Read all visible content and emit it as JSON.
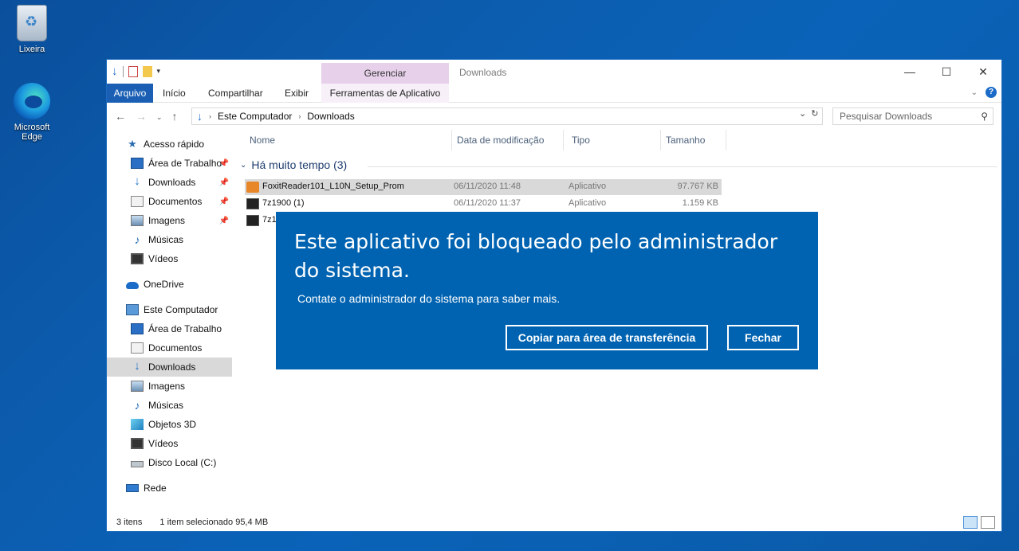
{
  "desktop": {
    "recycle_bin_label": "Lixeira",
    "edge_label": "Microsoft Edge"
  },
  "window": {
    "title": "Downloads",
    "contextual_group": "Gerenciar",
    "controls": [
      "—",
      "☐",
      "✕"
    ]
  },
  "ribbon": {
    "tabs": [
      "Arquivo",
      "Início",
      "Compartilhar",
      "Exibir",
      "Ferramentas de Aplicativo"
    ],
    "help": "?"
  },
  "address": {
    "breadcrumb": [
      "Este Computador",
      "Downloads"
    ],
    "search_placeholder": "Pesquisar Downloads"
  },
  "nav": {
    "items": [
      {
        "label": "Acesso rápido",
        "icon": "star-icon",
        "pinned": false
      },
      {
        "label": "Área de Trabalho",
        "icon": "desktop-icon",
        "pinned": true
      },
      {
        "label": "Downloads",
        "icon": "download-icon",
        "pinned": true
      },
      {
        "label": "Documentos",
        "icon": "document-icon",
        "pinned": true
      },
      {
        "label": "Imagens",
        "icon": "image-icon",
        "pinned": true
      },
      {
        "label": "Músicas",
        "icon": "music-icon",
        "pinned": false
      },
      {
        "label": "Vídeos",
        "icon": "video-icon",
        "pinned": false
      },
      {
        "label": "OneDrive",
        "icon": "cloud-icon",
        "pinned": false
      },
      {
        "label": "Este Computador",
        "icon": "computer-icon",
        "pinned": false
      },
      {
        "label": "Área de Trabalho",
        "icon": "desktop-icon",
        "pinned": false
      },
      {
        "label": "Documentos",
        "icon": "document-icon",
        "pinned": false
      },
      {
        "label": "Downloads",
        "icon": "download-icon",
        "pinned": false,
        "selected": true
      },
      {
        "label": "Imagens",
        "icon": "image-icon",
        "pinned": false
      },
      {
        "label": "Músicas",
        "icon": "music-icon",
        "pinned": false
      },
      {
        "label": "Objetos 3D",
        "icon": "cube-icon",
        "pinned": false
      },
      {
        "label": "Vídeos",
        "icon": "video-icon",
        "pinned": false
      },
      {
        "label": "Disco Local (C:)",
        "icon": "drive-icon",
        "pinned": false
      },
      {
        "label": "Rede",
        "icon": "network-icon",
        "pinned": false
      }
    ]
  },
  "files": {
    "columns": [
      "Nome",
      "Data de modificação",
      "Tipo",
      "Tamanho"
    ],
    "group_label": "Há muito tempo (3)",
    "rows": [
      {
        "name": "FoxitReader101_L10N_Setup_Prom",
        "date": "06/11/2020 11:48",
        "type": "Aplicativo",
        "size": "97.767 KB",
        "icon": "foxit-icon",
        "selected": true
      },
      {
        "name": "7z1900 (1)",
        "date": "06/11/2020 11:37",
        "type": "Aplicativo",
        "size": "1.159 KB",
        "icon": "7zip-icon",
        "selected": false
      },
      {
        "name": "7z1",
        "date": "",
        "type": "",
        "size": "",
        "icon": "7zip-icon",
        "selected": false
      }
    ]
  },
  "status": {
    "count": "3 itens",
    "selection": "1 item selecionado  95,4 MB"
  },
  "dialog": {
    "title": "Este aplicativo foi bloqueado pelo administrador do sistema.",
    "message": "Contate o administrador do sistema para saber mais.",
    "copy_button": "Copiar para área de transferência",
    "close_button": "Fechar",
    "color": "#0063b1"
  }
}
